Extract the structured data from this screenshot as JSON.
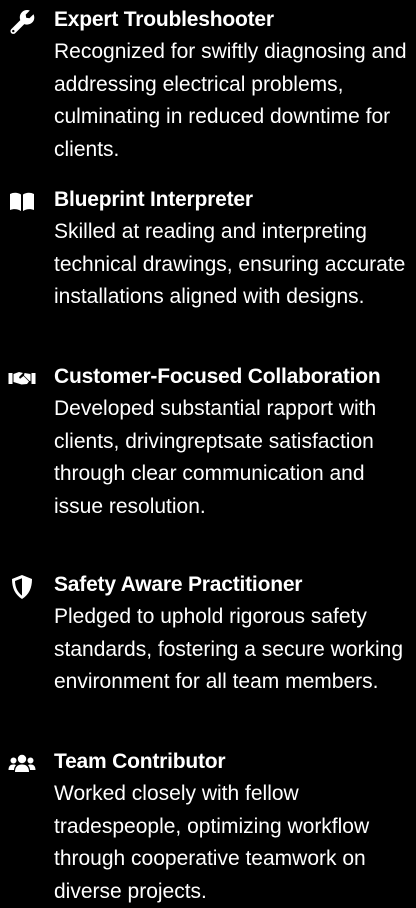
{
  "colors": {
    "background": "#000000",
    "text": "#ffffff"
  },
  "items": [
    {
      "icon": "wrench-icon",
      "title": "Expert Troubleshooter",
      "description": "Recognized for swiftly diagnosing and addressing electrical problems, culminating in reduced downtime for clients."
    },
    {
      "icon": "book-icon",
      "title": "Blueprint Interpreter",
      "description": "Skilled at reading and interpreting technical drawings, ensuring accurate installations aligned with designs."
    },
    {
      "icon": "handshake-icon",
      "title": "Customer-Focused Collaboration",
      "description": "Developed substantial rapport with clients, drivingreptsate satisfaction through clear communication and issue resolution."
    },
    {
      "icon": "shield-icon",
      "title": "Safety Aware Practitioner",
      "description": "Pledged to uphold rigorous safety standards, fostering a secure working environment for all team members."
    },
    {
      "icon": "users-icon",
      "title": "Team Contributor",
      "description": "Worked closely with fellow tradespeople, optimizing workflow through cooperative teamwork on diverse projects."
    }
  ]
}
